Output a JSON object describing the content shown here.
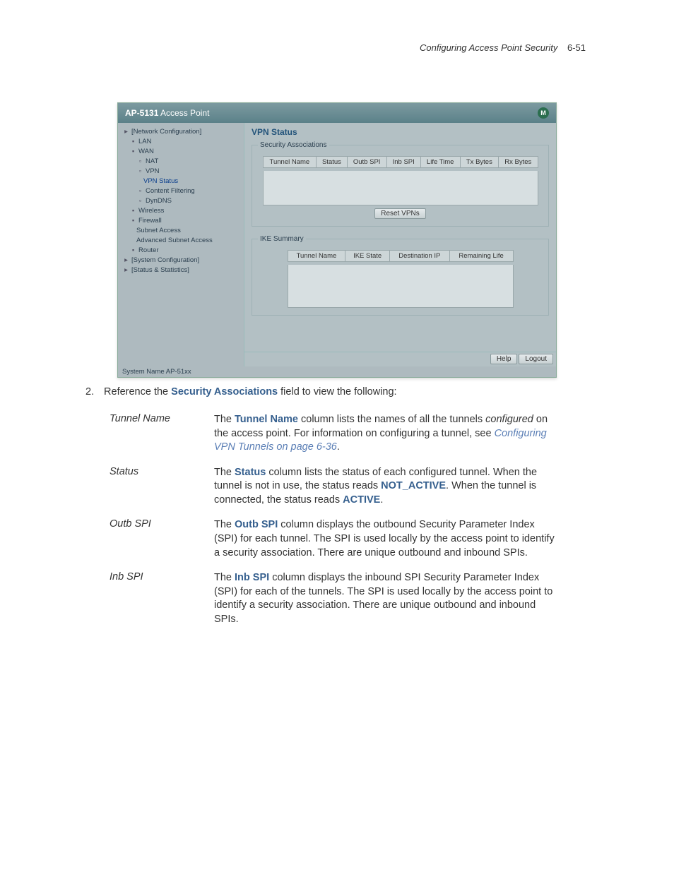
{
  "page_header": {
    "section": "Configuring Access Point Security",
    "page": "6-51"
  },
  "app": {
    "title_prefix": "AP-5131",
    "title_rest": " Access Point",
    "tree": {
      "network_configuration": "[Network Configuration]",
      "lan": "LAN",
      "wan": "WAN",
      "nat": "NAT",
      "vpn": "VPN",
      "vpn_status": "VPN Status",
      "content_filtering": "Content Filtering",
      "dyndns": "DynDNS",
      "wireless": "Wireless",
      "firewall": "Firewall",
      "subnet_access": "Subnet Access",
      "advanced_subnet_access": "Advanced Subnet Access",
      "router": "Router",
      "system_configuration": "[System Configuration]",
      "status_statistics": "[Status & Statistics]"
    },
    "main": {
      "heading": "VPN Status",
      "security_assoc_legend": "Security Associations",
      "security_assoc_cols": [
        "Tunnel Name",
        "Status",
        "Outb SPI",
        "Inb SPI",
        "Life Time",
        "Tx Bytes",
        "Rx Bytes"
      ],
      "reset_btn": "Reset VPNs",
      "ike_legend": "IKE Summary",
      "ike_cols": [
        "Tunnel Name",
        "IKE State",
        "Destination IP",
        "Remaining Life"
      ]
    },
    "footer": {
      "help": "Help",
      "logout": "Logout"
    },
    "system_name": "System Name AP-51xx"
  },
  "doc": {
    "step_num": "2.",
    "step_text_a": "Reference the ",
    "step_bold": "Security Associations",
    "step_text_b": " field to view the following:",
    "rows": [
      {
        "term": "Tunnel Name",
        "parts": [
          {
            "t": "The "
          },
          {
            "t": "Tunnel Name",
            "cls": "bold-blue"
          },
          {
            "t": " column lists the names of all the tunnels "
          },
          {
            "t": "configured",
            "cls": "italic"
          },
          {
            "t": " on the access point. For information on configuring a tunnel, see "
          },
          {
            "t": "Configuring VPN Tunnels on page 6-36",
            "cls": "link"
          },
          {
            "t": "."
          }
        ]
      },
      {
        "term": "Status",
        "parts": [
          {
            "t": "The "
          },
          {
            "t": "Status",
            "cls": "bold-blue"
          },
          {
            "t": " column lists the status of each configured tunnel. When the tunnel is not in use, the status reads "
          },
          {
            "t": "NOT_ACTIVE",
            "cls": "bold-blue"
          },
          {
            "t": ". When the tunnel is connected, the status reads "
          },
          {
            "t": "ACTIVE",
            "cls": "bold-blue"
          },
          {
            "t": "."
          }
        ]
      },
      {
        "term": "Outb SPI",
        "parts": [
          {
            "t": "The "
          },
          {
            "t": "Outb SPI",
            "cls": "bold-blue"
          },
          {
            "t": " column displays the outbound Security Parameter Index (SPI) for each tunnel. The SPI is used locally by the access point to identify a security association. There are unique outbound and inbound SPIs."
          }
        ]
      },
      {
        "term": "Inb SPI",
        "parts": [
          {
            "t": "The "
          },
          {
            "t": "Inb SPI",
            "cls": "bold-blue"
          },
          {
            "t": " column displays the inbound SPI Security Parameter Index (SPI) for each of the tunnels. The SPI is used locally by the access point to identify a security association. There are unique outbound and inbound SPIs."
          }
        ]
      }
    ]
  }
}
